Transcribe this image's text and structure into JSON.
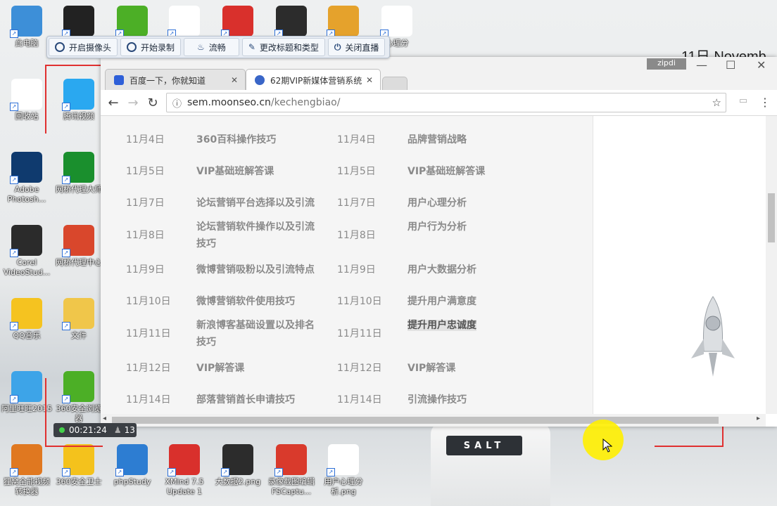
{
  "desktop": {
    "icons": [
      {
        "label": "此电脑",
        "color": "#3d8fd8"
      },
      {
        "label": "",
        "color": "#222"
      },
      {
        "label": "",
        "color": "#4caf26"
      },
      {
        "label": "",
        "color": "#ffffff"
      },
      {
        "label": "",
        "color": "#d9302c"
      },
      {
        "label": "",
        "color": "#2c2c2c"
      },
      {
        "label": "",
        "color": "#e5a22c"
      },
      {
        "label": "心理分",
        "color": "#ffffff"
      },
      {
        "label": "回收站",
        "color": "#ffffff"
      },
      {
        "label": "腾讯视频",
        "color": "#2aa8f0"
      },
      {
        "label": "Adobe Photosh...",
        "color": "#0f3a6e"
      },
      {
        "label": "网桥代理大师",
        "color": "#1a8f2d"
      },
      {
        "label": "Corel VideoStud...",
        "color": "#2b2b2b"
      },
      {
        "label": "网桥代理中心",
        "color": "#d9472c"
      },
      {
        "label": "QQ音乐",
        "color": "#f5c320"
      },
      {
        "label": "文件",
        "color": "#f0c64a"
      },
      {
        "label": "阿里旺旺2015",
        "color": "#3da4e8"
      },
      {
        "label": "360安全浏览器",
        "color": "#4caf26"
      },
      {
        "label": "狸窝全能视频转换器",
        "color": "#e07820"
      },
      {
        "label": "360安全卫士",
        "color": "#f4c21c"
      },
      {
        "label": "phpStudy",
        "color": "#2d7dd2"
      },
      {
        "label": "XMind 7.5 Update 1",
        "color": "#d9302c"
      },
      {
        "label": "大数据2.png",
        "color": "#2c2c2c"
      },
      {
        "label": "录像截图编辑FSCaptu...",
        "color": "#d93a2c"
      },
      {
        "label": "用户心理分析.png",
        "color": "#ffffff"
      }
    ],
    "background_date": "11日 Novemb",
    "jar_label": "SALT"
  },
  "recorder_toolbar": {
    "camera": "开启摄像头",
    "record": "开始录制",
    "quality": "流畅",
    "edit_title": "更改标题和类型",
    "stop_live": "关闭直播"
  },
  "recorder_status": {
    "time": "00:21:24",
    "viewers": "13"
  },
  "browser": {
    "tabs": [
      {
        "title": "百度一下，你就知道",
        "active": false
      },
      {
        "title": "62期VIP新媒体营销系统",
        "active": true
      }
    ],
    "url_domain": "sem.moonseo.cn",
    "url_path": "/kechengbiao/",
    "watermark": "zipdi"
  },
  "schedule": [
    {
      "date1": "11月4日",
      "topic1": "360百科操作技巧",
      "date2": "11月4日",
      "topic2": "品牌营销战略"
    },
    {
      "date1": "11月5日",
      "topic1": "VIP基础班解答课",
      "date2": "11月5日",
      "topic2": "VIP基础班解答课"
    },
    {
      "date1": "11月7日",
      "topic1": "论坛营销平台选择以及引流",
      "date2": "11月7日",
      "topic2": "用户心理分析"
    },
    {
      "date1": "11月8日",
      "topic1": "论坛营销软件操作以及引流技巧",
      "date2": "11月8日",
      "topic2": "用户行为分析"
    },
    {
      "date1": "11月9日",
      "topic1": "微博营销吸粉以及引流特点",
      "date2": "11月9日",
      "topic2": "用户大数据分析"
    },
    {
      "date1": "11月10日",
      "topic1": "微博营销软件使用技巧",
      "date2": "11月10日",
      "topic2": "提升用户满意度"
    },
    {
      "date1": "11月11日",
      "topic1": "新浪博客基础设置以及排名技巧",
      "date2": "11月11日",
      "topic2": "提升用户忠诚度"
    },
    {
      "date1": "11月12日",
      "topic1": "VIP解答课",
      "date2": "11月12日",
      "topic2": "VIP解答课"
    },
    {
      "date1": "11月14日",
      "topic1": "部落营销酋长申请技巧",
      "date2": "11月14日",
      "topic2": "引流操作技巧"
    }
  ]
}
